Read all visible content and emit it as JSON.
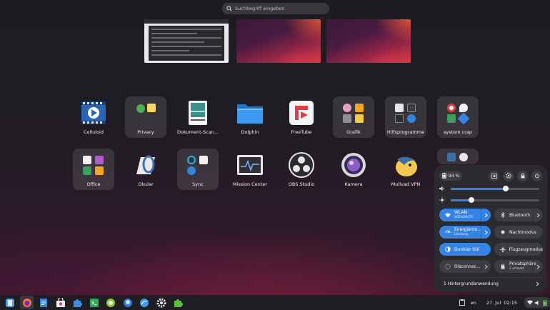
{
  "search": {
    "placeholder": "Suchbegriff eingeben"
  },
  "workspaces": [
    {
      "name": "workspace-1"
    },
    {
      "name": "workspace-2"
    },
    {
      "name": "workspace-3"
    }
  ],
  "apps": [
    {
      "label": "Celluloid",
      "icon": "celluloid-icon"
    },
    {
      "label": "Privacy",
      "icon": "privacy-folder-icon"
    },
    {
      "label": "Dokument-Scan...",
      "icon": "document-scanner-icon"
    },
    {
      "label": "Dolphin",
      "icon": "dolphin-icon"
    },
    {
      "label": "FreeTube",
      "icon": "freetube-icon"
    },
    {
      "label": "Grafik",
      "icon": "graphics-folder-icon"
    },
    {
      "label": "Hilfsprogramme",
      "icon": "utilities-folder-icon"
    },
    {
      "label": "system crap",
      "icon": "system-folder-icon"
    },
    {
      "label": "Office",
      "icon": "office-folder-icon"
    },
    {
      "label": "Okular",
      "icon": "okular-icon"
    },
    {
      "label": "Sync",
      "icon": "sync-folder-icon"
    },
    {
      "label": "Mission Center",
      "icon": "mission-center-icon"
    },
    {
      "label": "OBS Studio",
      "icon": "obs-icon"
    },
    {
      "label": "Kamera",
      "icon": "camera-icon"
    },
    {
      "label": "Mullvad VPN",
      "icon": "mullvad-icon"
    }
  ],
  "quick_settings": {
    "battery": "94 %",
    "volume_level": 0.62,
    "brightness_level": 0.23,
    "wlan": {
      "title": "WLAN",
      "subtitle": "WEHLMUTE"
    },
    "bluetooth": {
      "title": "Bluetooth"
    },
    "energy": {
      "title": "Energiemo...",
      "subtitle": "Leistung"
    },
    "night": {
      "title": "Nachtmodus"
    },
    "dark": {
      "title": "Dunkler Stil"
    },
    "airplane": {
      "title": "Flugzeugmodus"
    },
    "disconnect": {
      "title": "Disconnec..."
    },
    "privacy": {
      "title": "Privatsphäre",
      "subtitle": "2 erlaubt"
    },
    "background_apps": "1 Hintergrundanwendung"
  },
  "tray": {
    "lang": "en",
    "datetime": "27. Jul  02:15"
  },
  "colors": {
    "accent": "#3584e4",
    "panel": "#2b2a2e"
  }
}
